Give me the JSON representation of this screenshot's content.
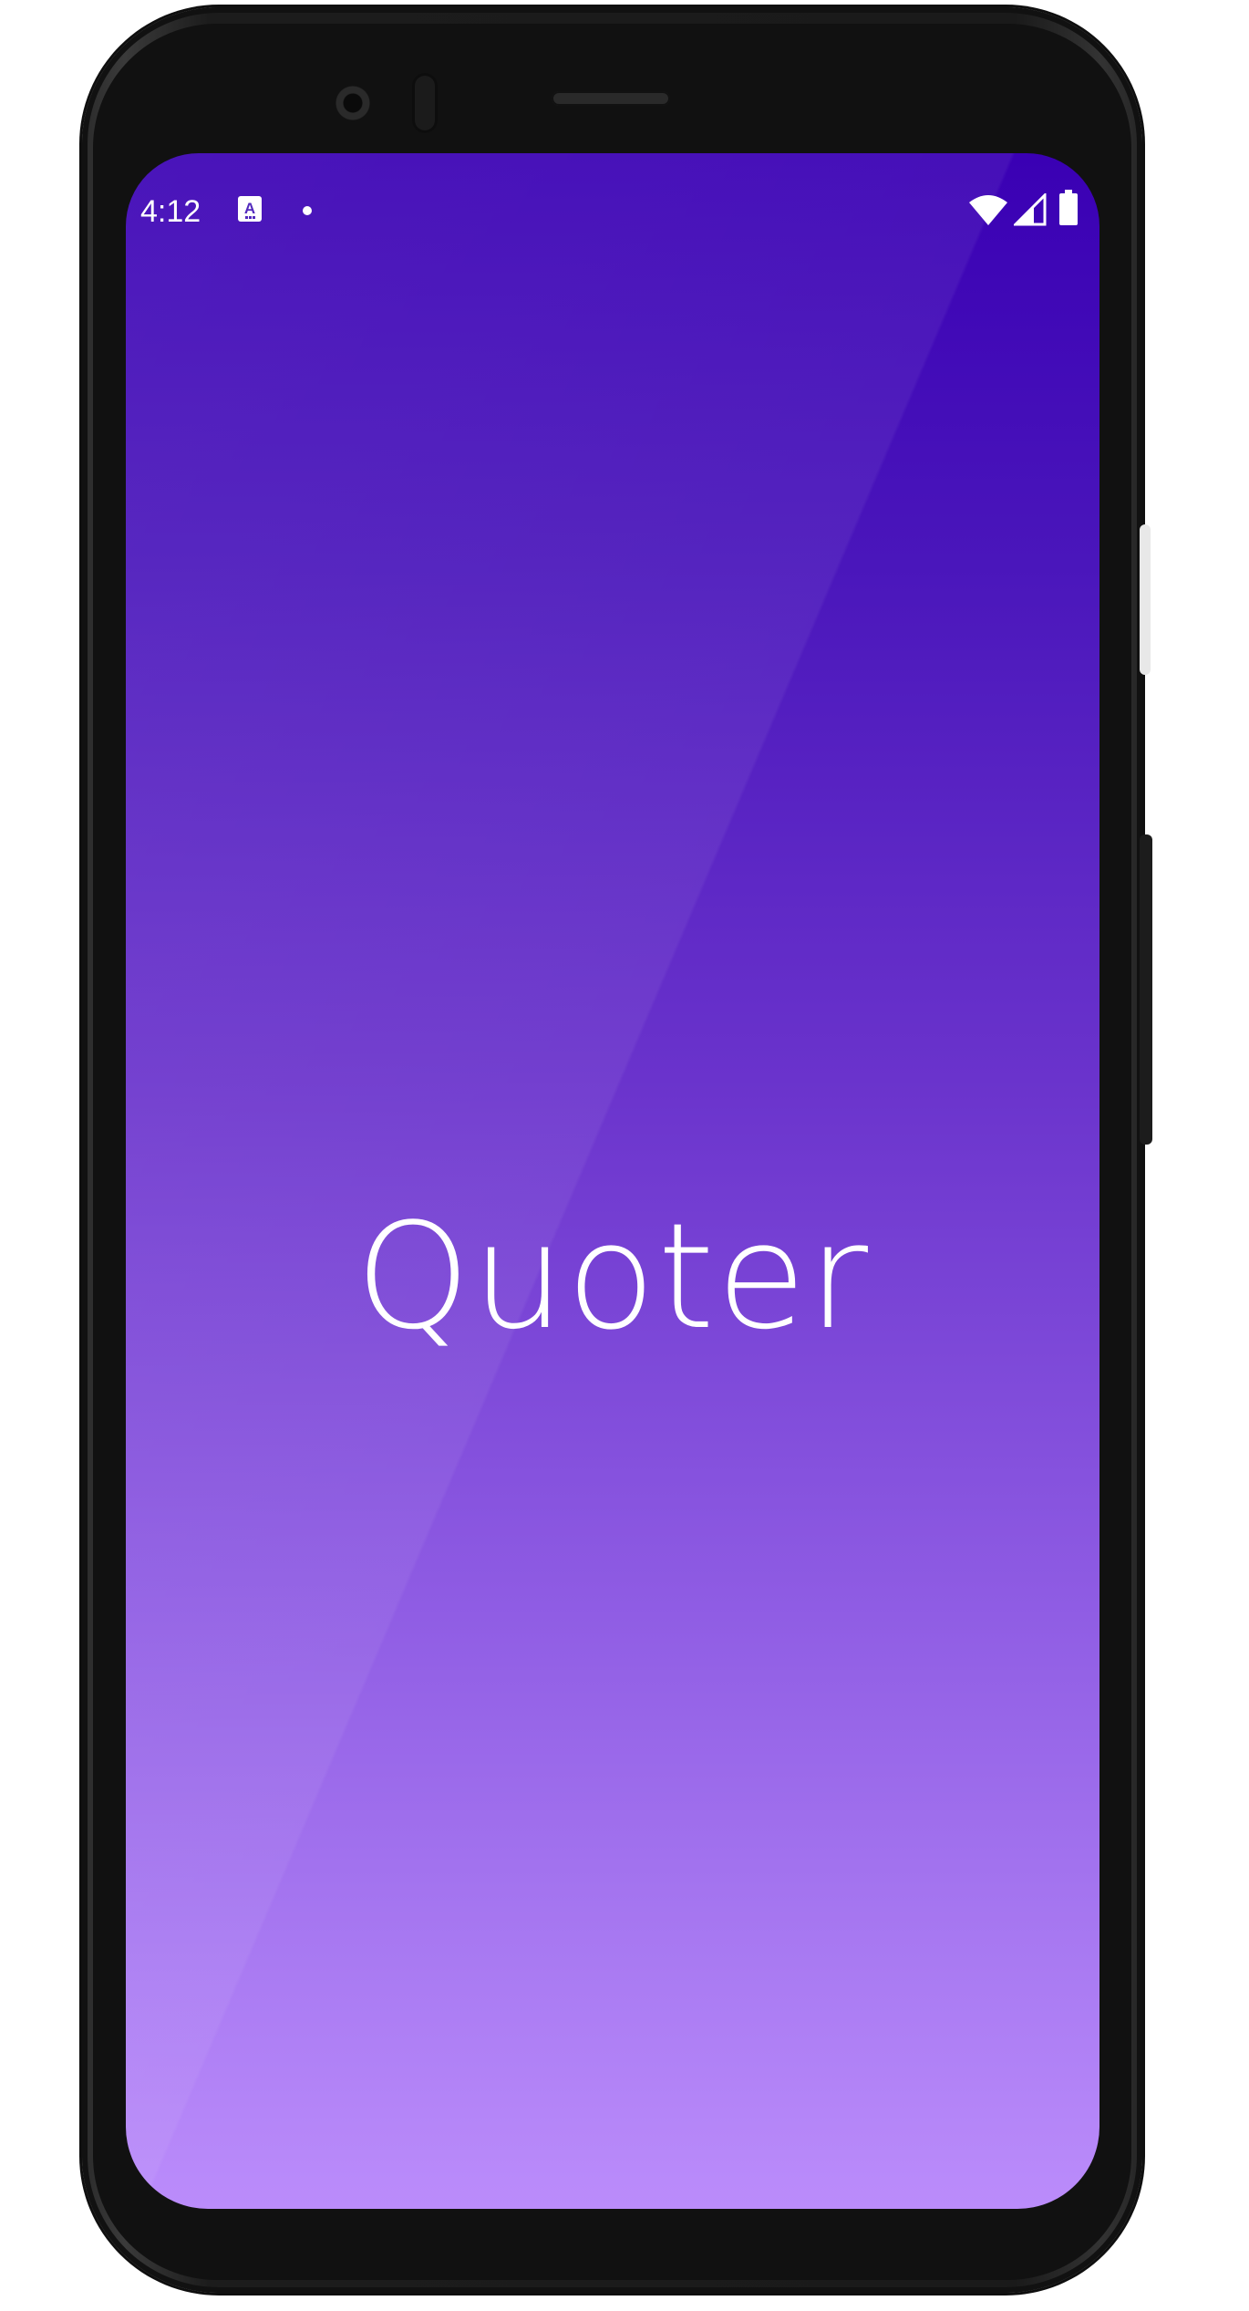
{
  "status_bar": {
    "time": "4:12",
    "icons": [
      "accessibility-a-icon",
      "notification-dot-icon",
      "wifi-icon",
      "cellular-signal-icon",
      "battery-icon"
    ]
  },
  "splash": {
    "app_name": "Quoter"
  },
  "colors": {
    "gradient_top": "#3a00b4",
    "gradient_bottom": "#bb8cfb",
    "text": "#ffffff",
    "device_frame": "#1a1a1a"
  }
}
